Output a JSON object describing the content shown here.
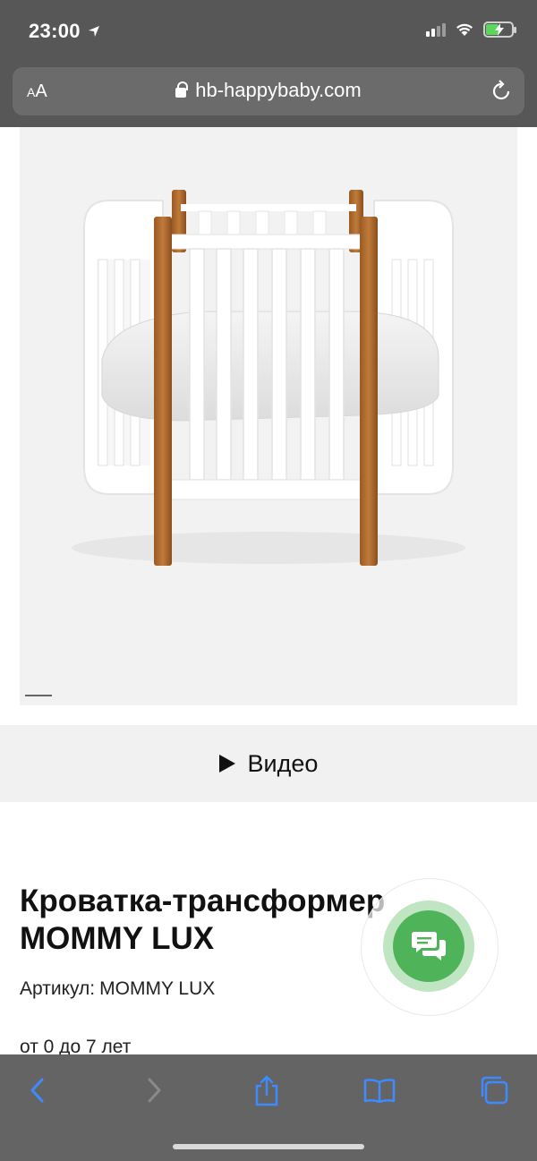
{
  "status_bar": {
    "time": "23:00",
    "icons": [
      "location-arrow-icon",
      "signal-icon",
      "wifi-icon",
      "battery-charging-icon"
    ]
  },
  "browser": {
    "text_size_label_small": "A",
    "text_size_label_large": "A",
    "url": "hb-happybaby.com",
    "reload_icon": "reload-icon"
  },
  "product": {
    "image_alt": "white oval transformer crib with wooden legs",
    "video_label": "Видео",
    "title": "Кроватка-трансформер MOMMY LUX",
    "sku_label": "Артикул:",
    "sku_value": "MOMMY LUX",
    "age": "от 0 до 7 лет"
  },
  "chat": {
    "icon": "chat-bubbles-icon",
    "accent": "#4fb35a"
  },
  "toolbar": {
    "items": [
      "back-icon",
      "forward-icon",
      "share-icon",
      "bookmarks-icon",
      "tabs-icon"
    ],
    "accent": "#3d8bff"
  }
}
